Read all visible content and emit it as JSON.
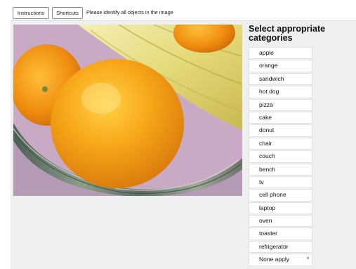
{
  "toolbar": {
    "instructions_label": "Instructions",
    "shortcuts_label": "Shortcuts",
    "prompt": "Please identify all objects in the image"
  },
  "sidebar": {
    "title": "Select appropriate categories",
    "categories": [
      {
        "label": "apple"
      },
      {
        "label": "orange"
      },
      {
        "label": "sandwich"
      },
      {
        "label": "hot dog"
      },
      {
        "label": "pizza"
      },
      {
        "label": "cake"
      },
      {
        "label": "donut"
      },
      {
        "label": "chair"
      },
      {
        "label": "couch"
      },
      {
        "label": "bench"
      },
      {
        "label": "tv"
      },
      {
        "label": "cell phone"
      },
      {
        "label": "laptop"
      },
      {
        "label": "oven"
      },
      {
        "label": "toaster"
      },
      {
        "label": "refrigerator"
      },
      {
        "label": "None apply",
        "hotkey": "n"
      }
    ]
  },
  "colors": {
    "workarea_bg": "#eef0ef",
    "orange": "#f39a12",
    "banana": "#e6dd7e",
    "basket": "#6f7e6c"
  }
}
